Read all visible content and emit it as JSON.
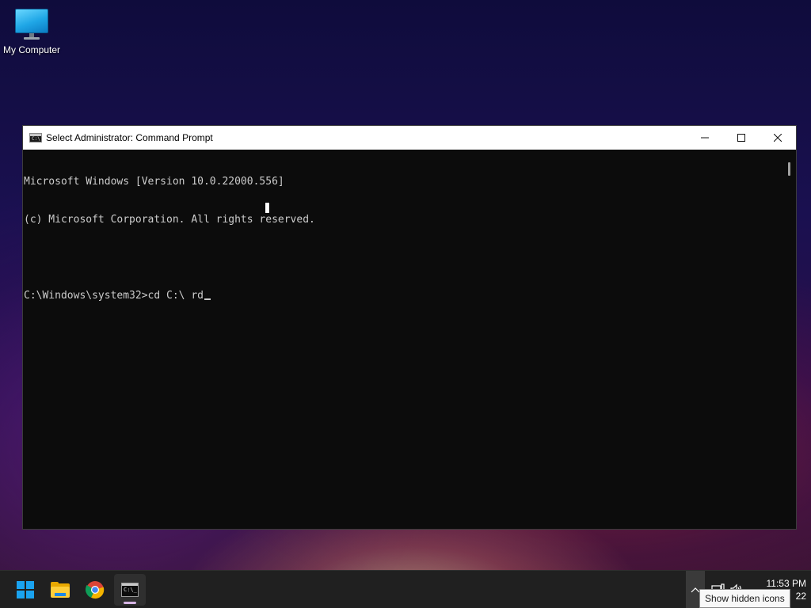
{
  "desktop": {
    "icons": [
      {
        "label": "My Computer",
        "icon": "monitor-icon"
      }
    ]
  },
  "window": {
    "title": "Select Administrator: Command Prompt",
    "icon": "command-prompt-icon",
    "controls": {
      "minimize": "minimize-icon",
      "maximize": "maximize-icon",
      "close": "close-icon"
    },
    "console_lines": [
      "Microsoft Windows [Version 10.0.22000.556]",
      "(c) Microsoft Corporation. All rights reserved.",
      "",
      "C:\\Windows\\system32>cd C:\\ rd"
    ]
  },
  "taskbar": {
    "apps": [
      {
        "name": "Start",
        "icon": "windows-start-icon"
      },
      {
        "name": "File Explorer",
        "icon": "folder-icon"
      },
      {
        "name": "Google Chrome",
        "icon": "chrome-icon"
      },
      {
        "name": "Command Prompt",
        "icon": "command-prompt-icon",
        "active": true
      }
    ],
    "tray": {
      "chevron_icon": "chevron-up-icon",
      "network_icon": "network-icon",
      "volume_icon": "volume-icon"
    },
    "clock": {
      "time": "11:53 PM",
      "date_visible": "22"
    }
  },
  "tooltip": {
    "text": "Show hidden icons"
  },
  "colors": {
    "console_bg": "#0c0c0c",
    "console_text": "#cccccc",
    "titlebar_bg": "#ffffff",
    "taskbar_bg": "#202020",
    "windows_blue": "#1aa3f0"
  }
}
